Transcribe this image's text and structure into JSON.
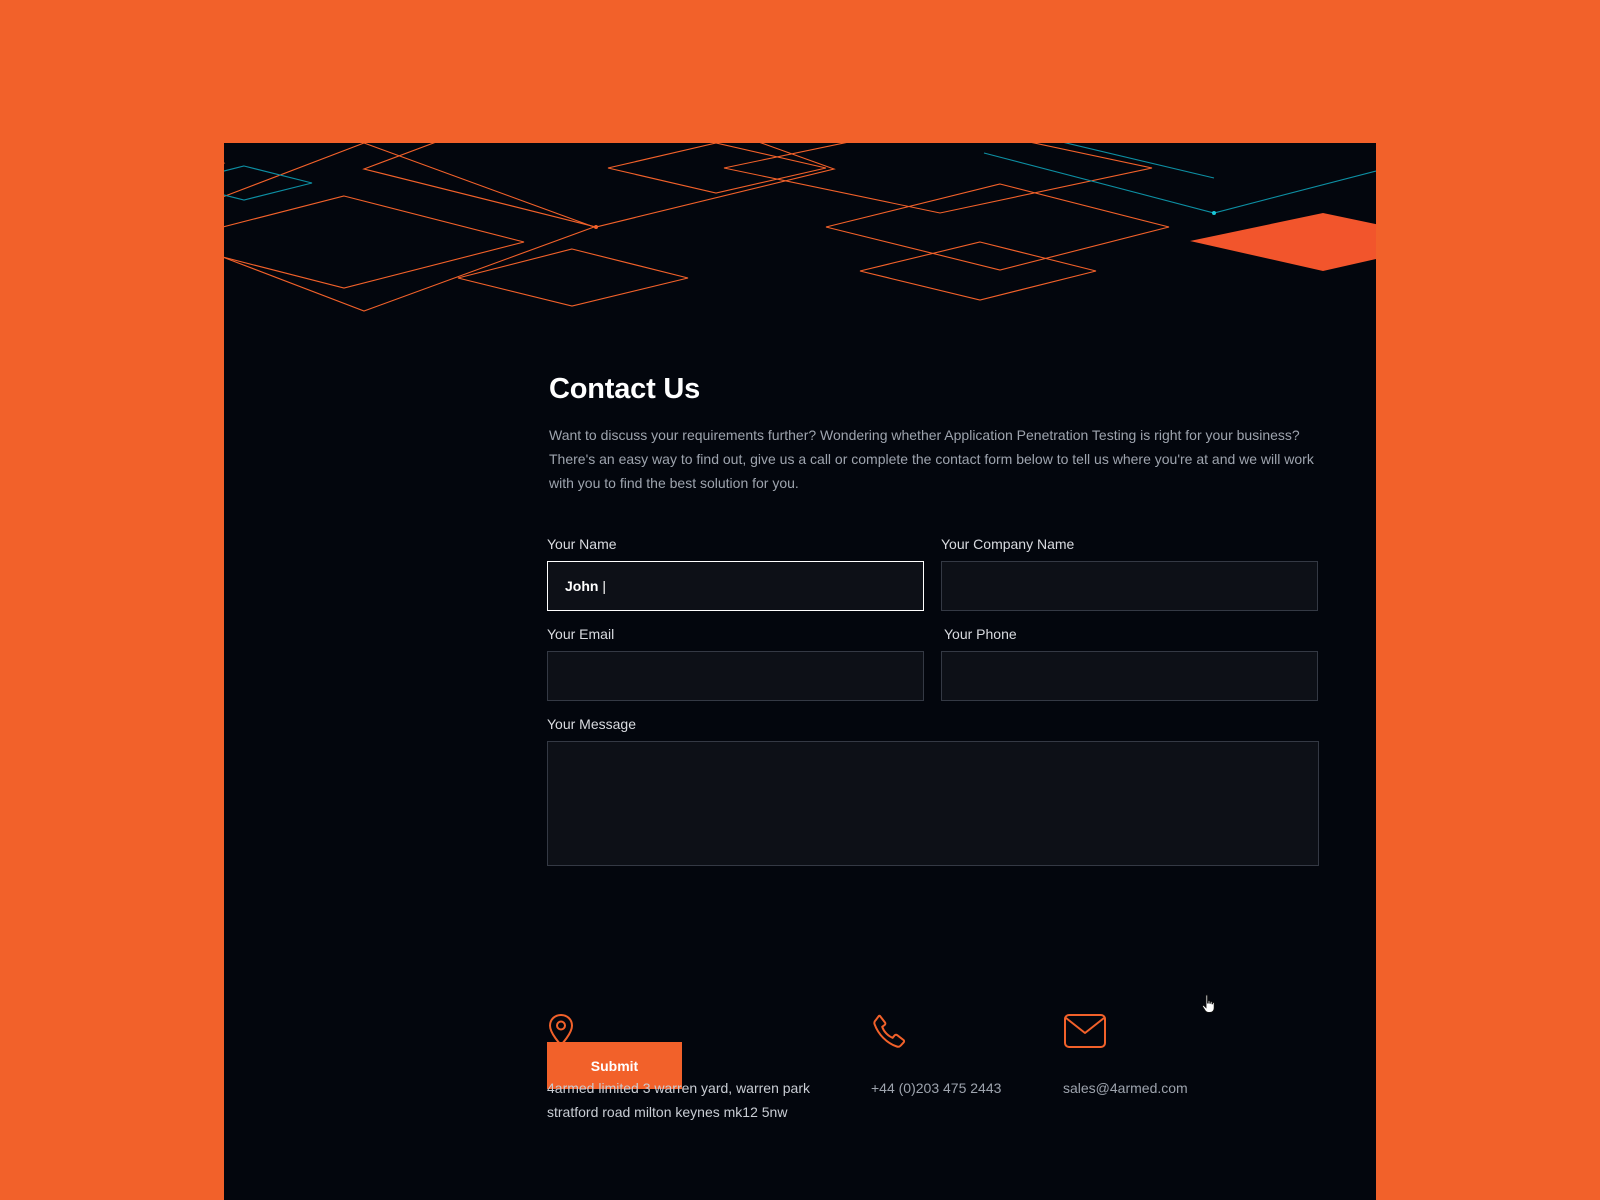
{
  "hero": {
    "accent_orange": "#f2612a",
    "accent_cyan": "#0d8fa3"
  },
  "header": {
    "title": "Contact Us",
    "intro": "Want to discuss your requirements further? Wondering whether Application Penetration Testing is right for your business? There's an easy way to find out, give us a call or complete the contact form below to tell us where you're at and we will work with you to find the best solution for you."
  },
  "form": {
    "name": {
      "label": "Your Name",
      "value": "John",
      "active": true
    },
    "company": {
      "label": "Your Company Name",
      "value": ""
    },
    "email": {
      "label": "Your Email",
      "value": ""
    },
    "phone": {
      "label": "Your Phone",
      "value": ""
    },
    "message": {
      "label": "Your Message",
      "value": ""
    },
    "submit_label": "Submit"
  },
  "contact": {
    "address": {
      "icon": "location-pin-icon",
      "line1": "4armed limited 3 warren yard, warren park",
      "line2": "stratford road  milton keynes mk12 5nw"
    },
    "phone": {
      "icon": "phone-icon",
      "text": "+44 (0)203 475 2443"
    },
    "email": {
      "icon": "mail-icon",
      "text": "sales@4armed.com"
    }
  },
  "colors": {
    "page_background": "#f2612a",
    "panel_background": "#03060d",
    "input_background": "#0d1017",
    "input_border": "#343944",
    "text_primary": "#ffffff",
    "text_muted": "#9ea4ae"
  }
}
